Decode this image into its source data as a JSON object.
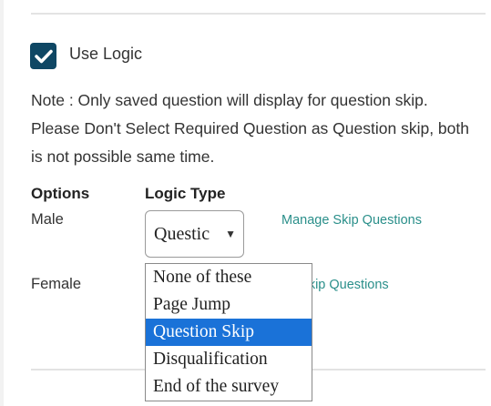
{
  "use_logic": {
    "label": "Use Logic",
    "checked": true
  },
  "note": "Note : Only saved question will display for question skip. Please Don't Select Required Question as Question skip, both is not possible same time.",
  "columns": {
    "options": "Options",
    "logic_type": "Logic Type"
  },
  "rows": [
    {
      "option": "Male",
      "select_value": "Questic",
      "manage_link": "Manage Skip Questions"
    },
    {
      "option": "Female",
      "manage_link_visible": "ge Skip Questions"
    }
  ],
  "dropdown_options": [
    {
      "label": "None of these",
      "selected": false
    },
    {
      "label": "Page Jump",
      "selected": false
    },
    {
      "label": "Question Skip",
      "selected": true
    },
    {
      "label": "Disqualification",
      "selected": false
    },
    {
      "label": "End of the survey",
      "selected": false
    }
  ],
  "colors": {
    "checkbox": "#0f4764",
    "link": "#2a8f8a",
    "selection": "#1a72d8"
  }
}
